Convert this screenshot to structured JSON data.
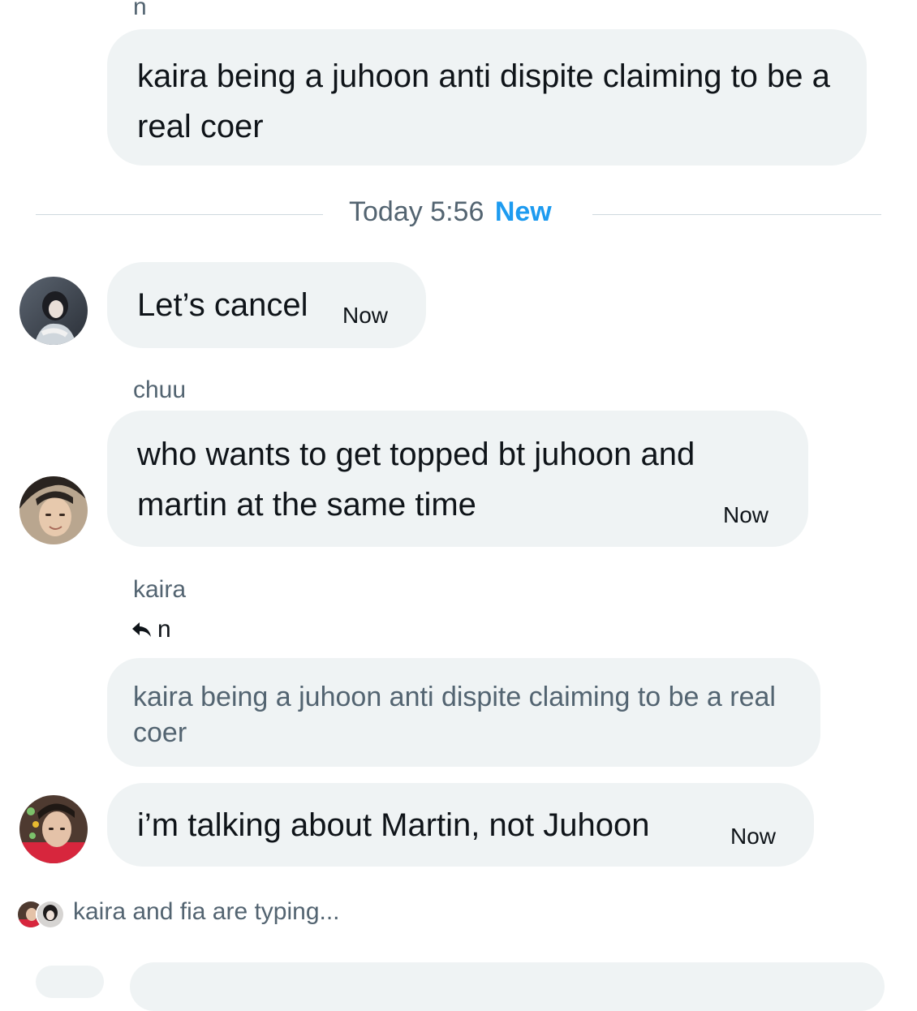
{
  "top_reply": {
    "reply_to_name": "n",
    "text": "kaira being a juhoon anti dispite claiming to be a real coer"
  },
  "divider": {
    "day_time": "Today 5:56",
    "new_label": "New"
  },
  "messages": [
    {
      "sender": "",
      "text": "Let’s cancel",
      "time": "Now"
    },
    {
      "sender": "chuu",
      "text": "who wants to get topped bt juhoon and martin at the same time",
      "time": "Now"
    },
    {
      "sender": "kaira",
      "reply_to_name": "n",
      "quoted_text": "kaira being a juhoon anti dispite claiming to be a real coer",
      "text": "i’m talking about Martin, not Juhoon",
      "time": "Now"
    }
  ],
  "typing": {
    "text": "kaira and fia are typing..."
  },
  "colors": {
    "bubble": "#eff3f4",
    "accent": "#1d9bf0",
    "muted": "#536471",
    "divider": "#cfd9de"
  }
}
